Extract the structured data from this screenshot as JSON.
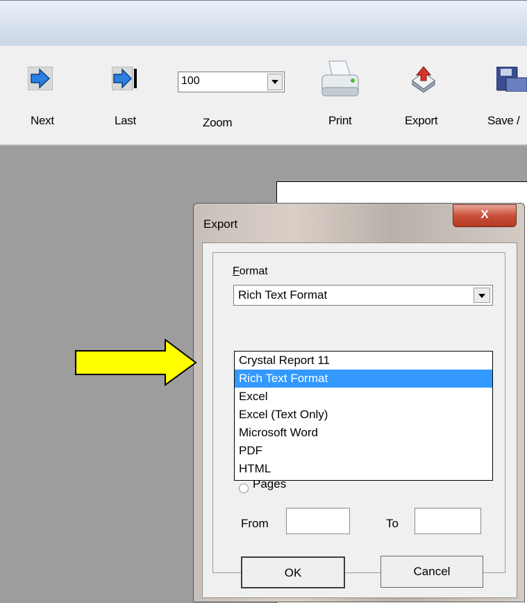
{
  "toolbar": {
    "items": [
      {
        "label": "Next",
        "icon": "next-arrow-icon"
      },
      {
        "label": "Last",
        "icon": "last-arrow-icon"
      },
      {
        "label": "Zoom",
        "icon": "zoom-combo"
      },
      {
        "label": "Print",
        "icon": "printer-icon"
      },
      {
        "label": "Export",
        "icon": "export-icon"
      },
      {
        "label": "Save /",
        "icon": "save-icon"
      }
    ],
    "zoom_value": "100"
  },
  "dialog": {
    "title": "Export",
    "close_label": "X",
    "format_label": "Format",
    "format_selected": "Rich Text Format",
    "format_options": [
      "Crystal Report 11",
      "Rich Text Format",
      "Excel",
      "Excel (Text Only)",
      "Microsoft Word",
      "PDF",
      "HTML"
    ],
    "pages_label": "Pages",
    "from_label": "From",
    "to_label": "To",
    "from_value": "",
    "to_value": "",
    "ok_label": "OK",
    "cancel_label": "Cancel"
  },
  "colors": {
    "selection": "#3399ff",
    "annotation_arrow": "#ffff00",
    "close_button": "#c9503a"
  }
}
